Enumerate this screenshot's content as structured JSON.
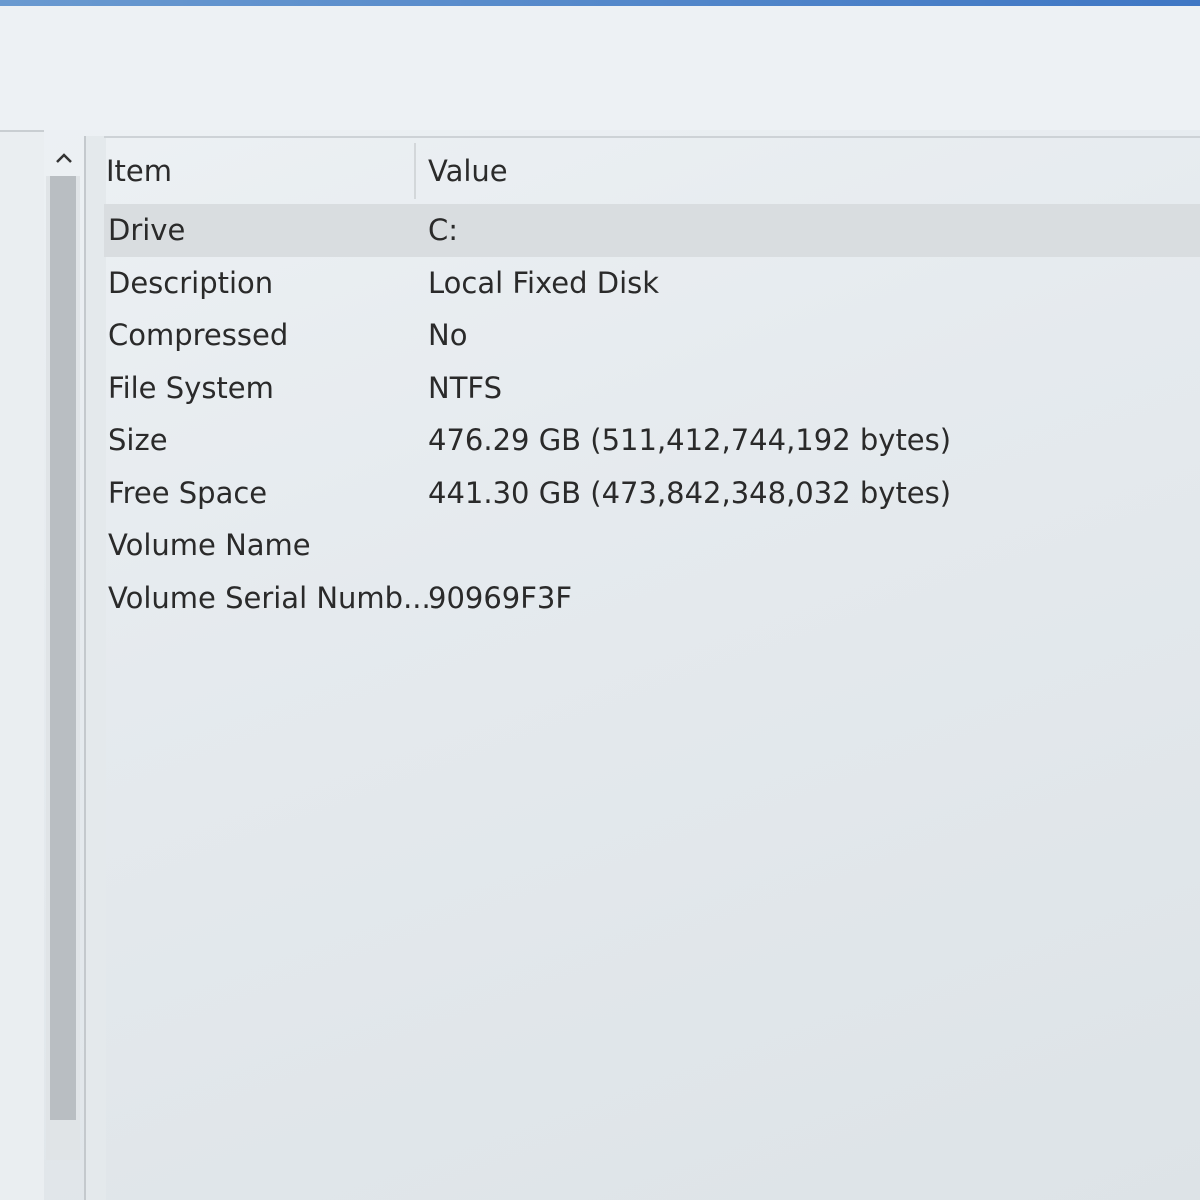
{
  "table": {
    "columns": {
      "item": "Item",
      "value": "Value"
    },
    "rows": [
      {
        "item": "Drive",
        "value": "C:"
      },
      {
        "item": "Description",
        "value": "Local Fixed Disk"
      },
      {
        "item": "Compressed",
        "value": "No"
      },
      {
        "item": "File System",
        "value": "NTFS"
      },
      {
        "item": "Size",
        "value": "476.29 GB (511,412,744,192 bytes)"
      },
      {
        "item": "Free Space",
        "value": "441.30 GB (473,842,348,032 bytes)"
      },
      {
        "item": "Volume Name",
        "value": ""
      },
      {
        "item": "Volume Serial Numb...",
        "value": "90969F3F"
      }
    ]
  },
  "scroll": {
    "up_icon": "chevron-up-icon"
  }
}
